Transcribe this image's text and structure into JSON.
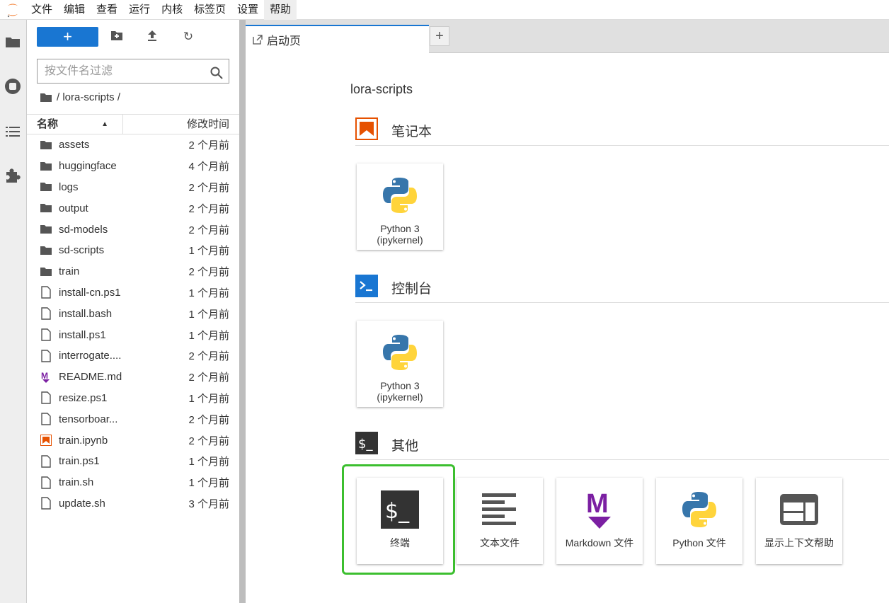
{
  "menu": [
    "文件",
    "编辑",
    "查看",
    "运行",
    "内核",
    "标签页",
    "设置",
    "帮助"
  ],
  "filebrowser": {
    "filter_placeholder": "按文件名过滤",
    "breadcrumb": "/ lora-scripts /",
    "col_name": "名称",
    "col_modified": "修改时间",
    "files": [
      {
        "name": "assets",
        "type": "folder",
        "modified": "2 个月前"
      },
      {
        "name": "huggingface",
        "type": "folder",
        "modified": "4 个月前"
      },
      {
        "name": "logs",
        "type": "folder",
        "modified": "2 个月前"
      },
      {
        "name": "output",
        "type": "folder",
        "modified": "2 个月前"
      },
      {
        "name": "sd-models",
        "type": "folder",
        "modified": "2 个月前"
      },
      {
        "name": "sd-scripts",
        "type": "folder",
        "modified": "1 个月前"
      },
      {
        "name": "train",
        "type": "folder",
        "modified": "2 个月前"
      },
      {
        "name": "install-cn.ps1",
        "type": "file",
        "modified": "1 个月前"
      },
      {
        "name": "install.bash",
        "type": "file",
        "modified": "1 个月前"
      },
      {
        "name": "install.ps1",
        "type": "file",
        "modified": "1 个月前"
      },
      {
        "name": "interrogate....",
        "type": "file",
        "modified": "2 个月前"
      },
      {
        "name": "README.md",
        "type": "markdown",
        "modified": "2 个月前"
      },
      {
        "name": "resize.ps1",
        "type": "file",
        "modified": "1 个月前"
      },
      {
        "name": "tensorboar...",
        "type": "file",
        "modified": "2 个月前"
      },
      {
        "name": "train.ipynb",
        "type": "notebook",
        "modified": "2 个月前"
      },
      {
        "name": "train.ps1",
        "type": "file",
        "modified": "1 个月前"
      },
      {
        "name": "train.sh",
        "type": "file",
        "modified": "1 个月前"
      },
      {
        "name": "update.sh",
        "type": "file",
        "modified": "3 个月前"
      }
    ]
  },
  "tabs": {
    "launcher_label": "启动页",
    "add_label": "+"
  },
  "launcher": {
    "cwd": "lora-scripts",
    "notebook_section": "笔记本",
    "console_section": "控制台",
    "other_section": "其他",
    "kernel_line1": "Python 3",
    "kernel_line2": "(ipykernel)",
    "other_items": [
      "终端",
      "文本文件",
      "Markdown 文件",
      "Python 文件",
      "显示上下文帮助"
    ]
  },
  "colors": {
    "accent": "#1976d2",
    "highlight": "#3cbf2f",
    "notebook": "#e65100",
    "markdown": "#7b1fa2"
  }
}
